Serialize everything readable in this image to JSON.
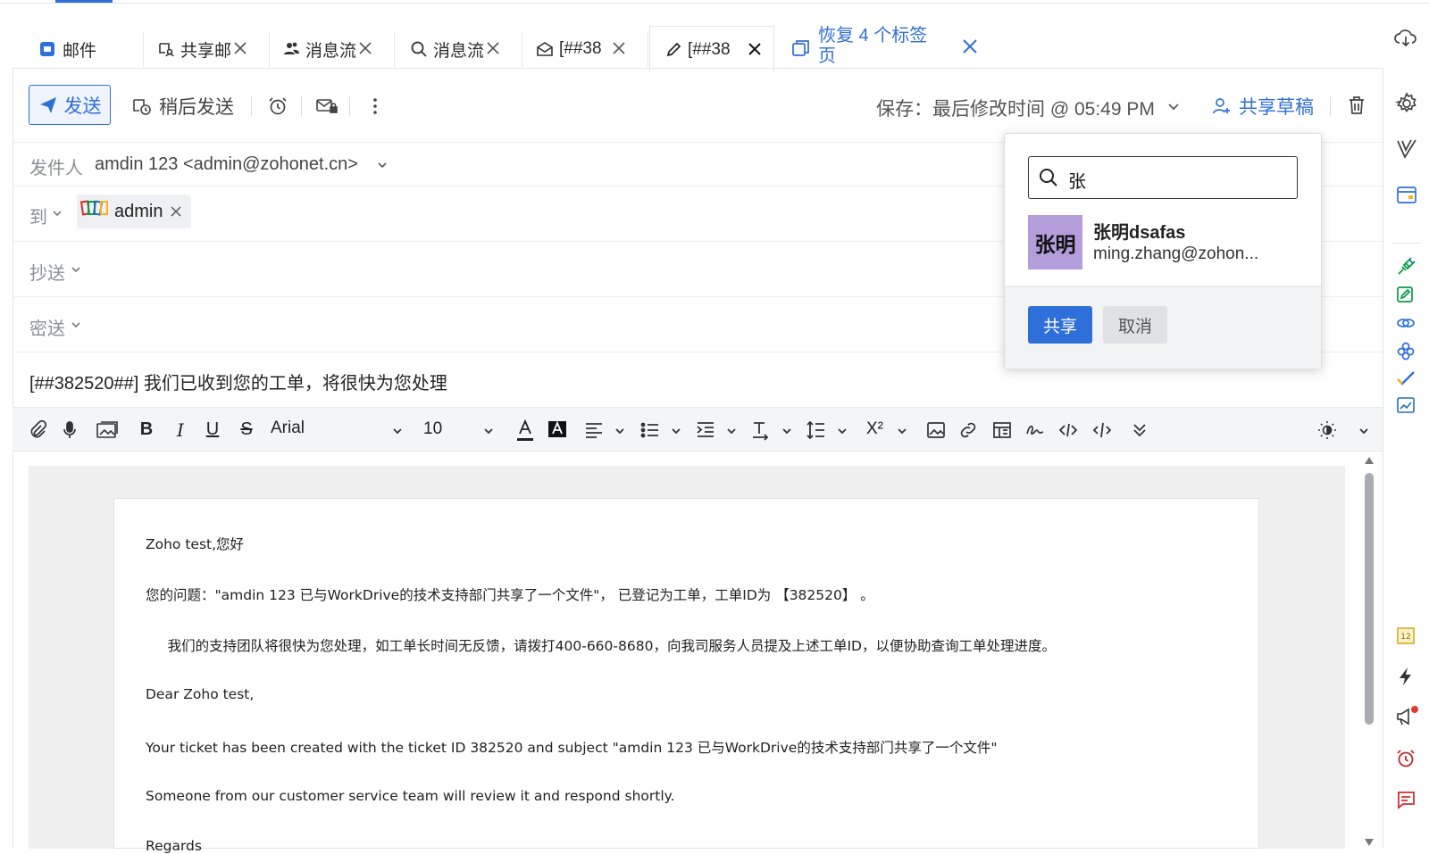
{
  "tabs": [
    {
      "label": "邮件",
      "icon": "mail-icon"
    },
    {
      "label": "共享邮",
      "icon": "shared-mail-icon"
    },
    {
      "label": "消息流",
      "icon": "users-icon"
    },
    {
      "label": "消息流",
      "icon": "search-icon"
    },
    {
      "label": "[##38",
      "icon": "envelope-open-icon"
    },
    {
      "label": "[##38",
      "icon": "pencil-icon"
    }
  ],
  "restore_tabs": {
    "line1": "恢复 4 个标签",
    "line2": "页"
  },
  "toolbar": {
    "send_label": "发送",
    "send_later_label": "稍后发送",
    "save_status": "保存：最后修改时间 @ 05:49 PM",
    "share_draft_label": "共享草稿"
  },
  "fields": {
    "from_label": "发件人",
    "from_value": "amdin 123 <admin@zohonet.cn>",
    "to_label": "到",
    "to_chip": "admin",
    "cc_label": "抄送",
    "bcc_label": "密送",
    "subject": "[##382520##] 我们已收到您的工单，将很快为您处理"
  },
  "format": {
    "font_family": "Arial",
    "font_size": "10"
  },
  "body": {
    "lines": [
      "Zoho test,您好",
      "您的问题：\"amdin 123 已与WorkDrive的技术支持部门共享了一个文件\"， 已登记为工单，工单ID为 【382520】 。",
      "     我们的支持团队将很快为您处理，如工单长时间无反馈，请拨打400-660-8680，向我司服务人员提及上述工单ID，以便协助查询工单处理进度。",
      "Dear Zoho test,",
      "Your ticket has been created with the ticket ID 382520 and subject \"amdin 123 已与WorkDrive的技术支持部门共享了一个文件\"",
      "Someone from our customer service team will review it and respond shortly.",
      "Regards"
    ]
  },
  "share_popover": {
    "search_value": "张",
    "result_avatar": "张明",
    "result_name": "张明dsafas",
    "result_email": "ming.zhang@zohon...",
    "share_label": "共享",
    "cancel_label": "取消"
  },
  "colors": {
    "accent": "#2f6fd9",
    "avatar": "#b39ddb",
    "notification_dot": "#e53935"
  }
}
